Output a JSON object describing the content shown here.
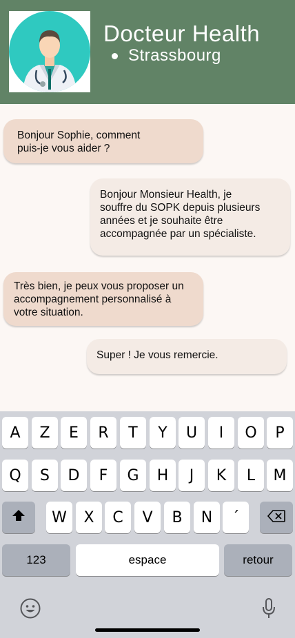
{
  "header": {
    "doctor_name": "Docteur Health",
    "location": "Strassbourg",
    "avatar_icon": "doctor-avatar-icon",
    "background_color": "#618366"
  },
  "messages": [
    {
      "direction": "incoming",
      "text": "Bonjour Sophie, comment\npuis-je vous aider ?"
    },
    {
      "direction": "outgoing",
      "text": "Bonjour Monsieur Health, je\nsouffre du SOPK depuis plusieurs\nannées et je souhaite être\naccompagnée par un spécialiste."
    },
    {
      "direction": "incoming",
      "text": "Très bien, je peux vous proposer un\naccompagnement personnalisé à\nvotre situation."
    },
    {
      "direction": "outgoing",
      "text": "Super ! Je vous remercie."
    }
  ],
  "keyboard": {
    "row1": [
      "A",
      "Z",
      "E",
      "R",
      "T",
      "Y",
      "U",
      "I",
      "O",
      "P"
    ],
    "row2": [
      "Q",
      "S",
      "D",
      "F",
      "G",
      "H",
      "J",
      "K",
      "L",
      "M"
    ],
    "row3": [
      "W",
      "X",
      "C",
      "V",
      "B",
      "N",
      "´"
    ],
    "numbers_label": "123",
    "space_label": "espace",
    "return_label": "retour",
    "shift_icon": "shift-icon",
    "delete_icon": "backspace-icon",
    "emoji_icon": "emoji-icon",
    "mic_icon": "microphone-icon"
  }
}
